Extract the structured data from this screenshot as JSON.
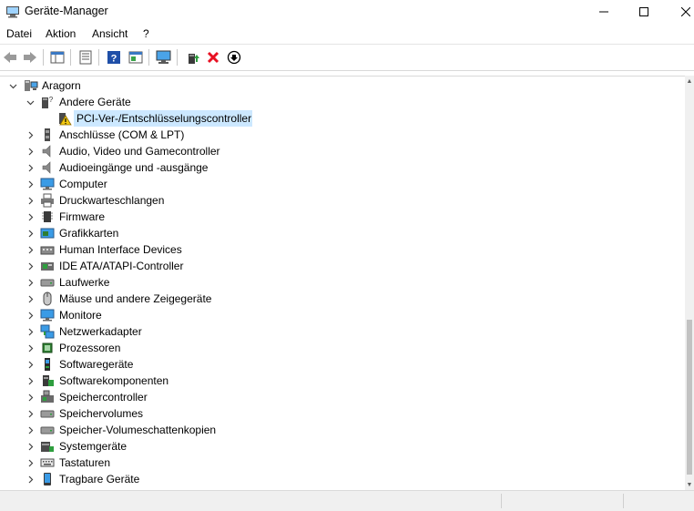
{
  "window": {
    "title": "Geräte-Manager",
    "icons": {
      "app": "device-manager-icon",
      "minimize": "minimize-icon",
      "maximize": "maximize-icon",
      "close": "close-icon"
    }
  },
  "menu": {
    "items": [
      {
        "label": "Datei"
      },
      {
        "label": "Aktion"
      },
      {
        "label": "Ansicht"
      },
      {
        "label": "?"
      }
    ]
  },
  "toolbar": {
    "buttons": [
      {
        "icon": "back-arrow-icon"
      },
      {
        "icon": "forward-arrow-icon"
      },
      {
        "icon": "show-hide-console-tree-icon"
      },
      {
        "icon": "properties-icon"
      },
      {
        "icon": "help-icon"
      },
      {
        "icon": "action-pane-icon"
      },
      {
        "icon": "scan-hardware-changes-icon"
      },
      {
        "icon": "update-driver-icon"
      },
      {
        "icon": "uninstall-device-icon"
      },
      {
        "icon": "disable-device-icon"
      }
    ]
  },
  "tree": {
    "root": {
      "label": "Aragorn",
      "icon": "computer-root-icon",
      "expanded": true
    },
    "children": [
      {
        "label": "Andere Geräte",
        "icon": "unknown-device-icon",
        "expanded": true,
        "children": [
          {
            "label": "PCI-Ver-/Entschlüsselungscontroller",
            "icon": "warning-device-icon",
            "selected": true
          }
        ]
      },
      {
        "label": "Anschlüsse (COM & LPT)",
        "icon": "port-icon"
      },
      {
        "label": "Audio, Video und Gamecontroller",
        "icon": "speaker-icon"
      },
      {
        "label": "Audioeingänge und -ausgänge",
        "icon": "speaker-icon"
      },
      {
        "label": "Computer",
        "icon": "monitor-icon"
      },
      {
        "label": "Druckwarteschlangen",
        "icon": "printer-icon"
      },
      {
        "label": "Firmware",
        "icon": "firmware-icon"
      },
      {
        "label": "Grafikkarten",
        "icon": "display-adapter-icon"
      },
      {
        "label": "Human Interface Devices",
        "icon": "hid-icon"
      },
      {
        "label": "IDE ATA/ATAPI-Controller",
        "icon": "ide-controller-icon"
      },
      {
        "label": "Laufwerke",
        "icon": "drive-icon"
      },
      {
        "label": "Mäuse und andere Zeigegeräte",
        "icon": "mouse-icon"
      },
      {
        "label": "Monitore",
        "icon": "monitor-icon"
      },
      {
        "label": "Netzwerkadapter",
        "icon": "network-adapter-icon"
      },
      {
        "label": "Prozessoren",
        "icon": "processor-icon"
      },
      {
        "label": "Softwaregeräte",
        "icon": "software-device-icon"
      },
      {
        "label": "Softwarekomponenten",
        "icon": "software-component-icon"
      },
      {
        "label": "Speichercontroller",
        "icon": "storage-controller-icon"
      },
      {
        "label": "Speichervolumes",
        "icon": "drive-icon"
      },
      {
        "label": "Speicher-Volumeschattenkopien",
        "icon": "drive-icon"
      },
      {
        "label": "Systemgeräte",
        "icon": "system-device-icon"
      },
      {
        "label": "Tastaturen",
        "icon": "keyboard-icon"
      },
      {
        "label": "Tragbare Geräte",
        "icon": "portable-device-icon"
      }
    ]
  },
  "colors": {
    "selection": "#cce8ff",
    "accent": "#0078d7",
    "warning": "#f2c811",
    "delete": "#e81123"
  }
}
